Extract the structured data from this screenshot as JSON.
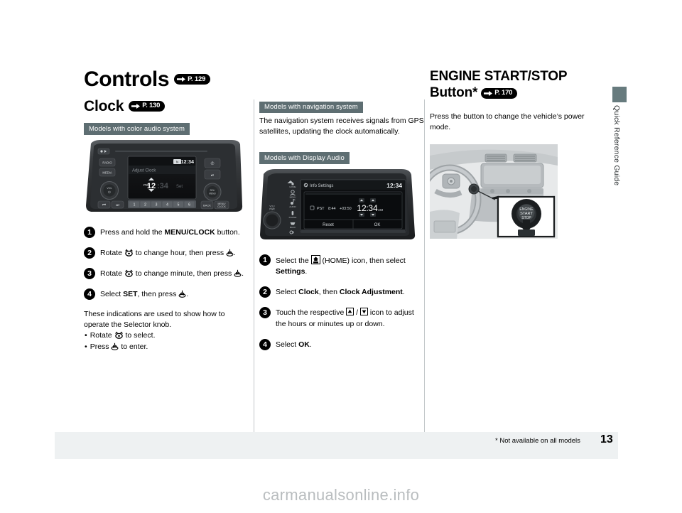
{
  "sidetab": {
    "label": "Quick Reference Guide",
    "color": "#677b7e"
  },
  "col1": {
    "title": "Controls",
    "title_ref": "P. 129",
    "subtitle": "Clock",
    "subtitle_ref": "P. 130",
    "badge": "Models with color audio system",
    "audio_unit": {
      "status_time": "12:34",
      "screen_title": "Adjust Clock",
      "ampm": "PM",
      "hour": "12",
      "colon": ":",
      "minute": "34",
      "set_label": "Set",
      "btn_radio": "RADIO",
      "btn_media": "MEDIA",
      "knob_vol": "VOL",
      "knob_sel": "SEL/ MENU",
      "btn_back": "BACK",
      "btn_menu": "MENU/ CLOCK",
      "presets": [
        "1",
        "2",
        "3",
        "4",
        "5",
        "6"
      ]
    },
    "steps": [
      {
        "n": "1",
        "pre": "Press and hold the ",
        "bold": "MENU/CLOCK",
        "post": " button."
      },
      {
        "n": "2",
        "pre": "Rotate ",
        "icon": "selector-rotate",
        "post": " to change hour, then press ",
        "icon2": "selector-press",
        "tail": "."
      },
      {
        "n": "3",
        "pre": "Rotate ",
        "icon": "selector-rotate",
        "post": " to change minute, then press ",
        "icon2": "selector-press",
        "tail": "."
      },
      {
        "n": "4",
        "pre": "Select ",
        "bold": "SET",
        "post": ", then press ",
        "icon2": "selector-press",
        "tail": "."
      }
    ],
    "note": "These indications are used to show how to operate the Selector knob.",
    "bullets": [
      {
        "pre": "Rotate ",
        "icon": "selector-rotate",
        "post": " to select."
      },
      {
        "pre": "Press ",
        "icon": "selector-press",
        "post": " to enter."
      }
    ]
  },
  "col2": {
    "badge_nav": "Models with navigation system",
    "nav_text": "The navigation system receives signals from GPS satellites, updating the clock automatically.",
    "badge_da": "Models with Display Audio",
    "da_unit": {
      "header_title": "Info Settings",
      "header_time": "12:34",
      "tz": "PST",
      "tz_time": "8:44",
      "tz_offset": "+03:50",
      "hour": "12",
      "colon": ":",
      "minute": "34",
      "ampm": "AM",
      "reset": "Reset",
      "ok": "OK",
      "side_icons": [
        "HOME",
        "MENU",
        "AUDIO",
        "PHONE",
        "BACK",
        "DISPLAY"
      ],
      "knob_label": "VOL/ PWR"
    },
    "steps": [
      {
        "n": "1",
        "pre": "Select the ",
        "icon": "home-icon",
        "mid": " (HOME) icon, then select ",
        "bold": "Settings",
        "tail": "."
      },
      {
        "n": "2",
        "pre": "Select ",
        "bold": "Clock",
        "mid": ", then ",
        "bold2": "Clock Adjustment",
        "tail": "."
      },
      {
        "n": "3",
        "pre": "Touch the respective ",
        "icon": "arrow-up-icon",
        "sep": " / ",
        "icon2": "arrow-down-icon",
        "post": " icon to adjust the hours or minutes up or down."
      },
      {
        "n": "4",
        "pre": "Select ",
        "bold": "OK",
        "tail": "."
      }
    ]
  },
  "col3": {
    "title_line1": "ENGINE START/STOP",
    "title_line2": "Button",
    "asterisk": "*",
    "title_ref": "P. 170",
    "intro": "Press the button to change the vehicle’s power mode.",
    "button_label_1": "ENGINE",
    "button_label_2": "START",
    "button_label_3": "STOP"
  },
  "footer": {
    "note": "* Not available on all models",
    "page": "13"
  },
  "watermark": "carmanualsonline.info"
}
